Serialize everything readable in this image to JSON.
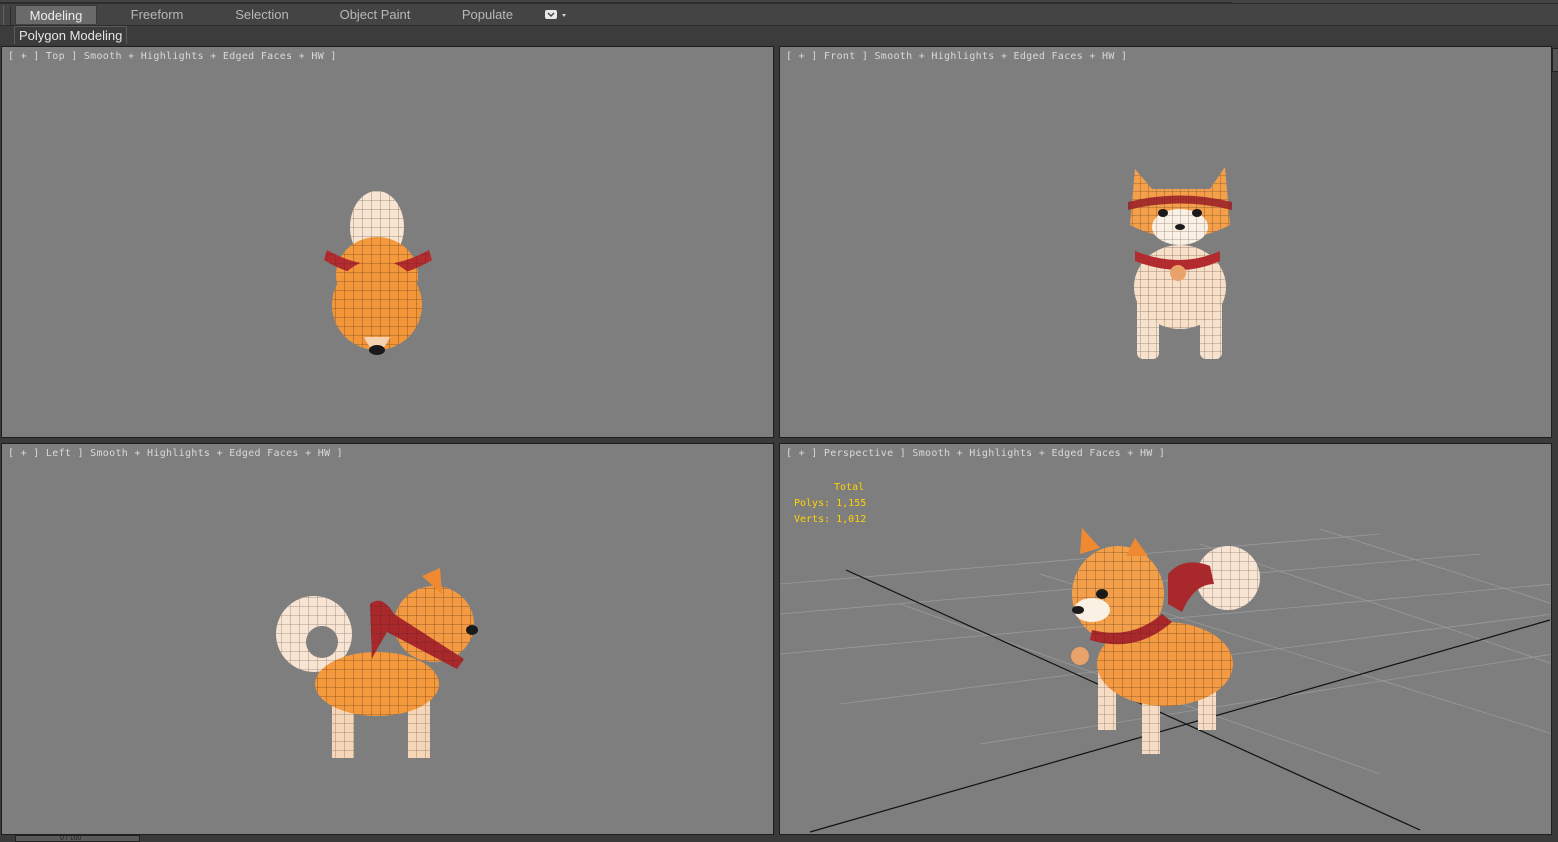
{
  "ribbon": {
    "tabs": [
      "Modeling",
      "Freeform",
      "Selection",
      "Object Paint",
      "Populate"
    ],
    "active_tab": "Modeling",
    "panel_label": "Polygon Modeling"
  },
  "viewports": {
    "top": {
      "label": "[ + ] Top ] Smooth + Highlights + Edged Faces + HW ]"
    },
    "front": {
      "label": "[ + ] Front ] Smooth + Highlights + Edged Faces + HW ]"
    },
    "left": {
      "label": "[ + ] Left ] Smooth + Highlights + Edged Faces + HW ]"
    },
    "perspective": {
      "label": "[ + ] Perspective ] Smooth + Highlights + Edged Faces + HW ]"
    }
  },
  "stats": {
    "title": "Total",
    "polys": "Polys: 1,155",
    "verts": "Verts: 1,012"
  },
  "time_slider": {
    "label": "0 / 100"
  },
  "colors": {
    "viewport_bg": "#7e7e7e",
    "stats_text": "#ffd400",
    "model_orange": "#f59a3c",
    "model_cream": "#f6dcc4",
    "scarf_red": "#a8282b"
  }
}
